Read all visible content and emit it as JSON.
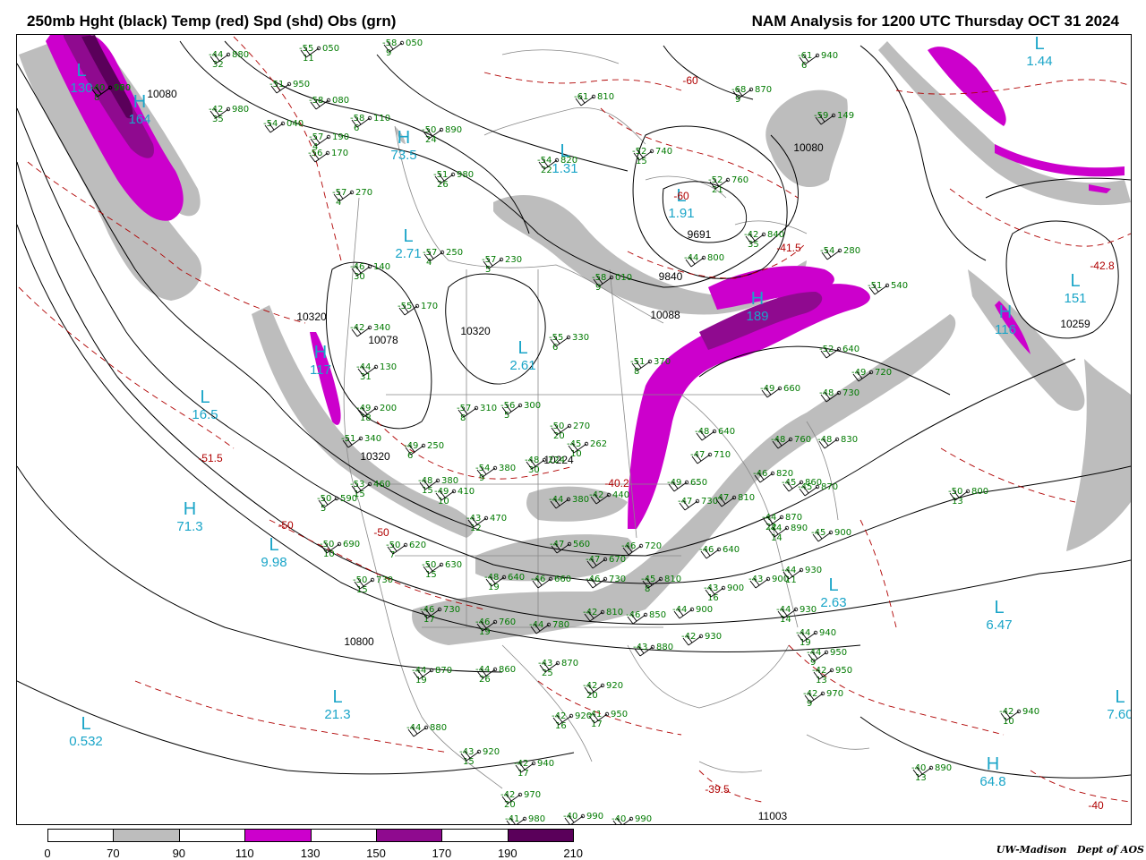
{
  "header": {
    "left_title": "250mb Hght (black) Temp (red) Spd (shd) Obs (grn)",
    "right_title": "NAM Analysis for 1200 UTC Thursday  OCT 31 2024"
  },
  "colors": {
    "height_contours": "#000000",
    "temperature_contours": "#b00000",
    "observations": "#007a00",
    "center_labels": "#1aa5c8",
    "speed_70_90": "#bdbdbd",
    "speed_110_130": "#cc00cc",
    "speed_150_170": "#8f0a8f",
    "speed_190_210": "#5a005a"
  },
  "centers": [
    {
      "type": "L",
      "value": "1.44"
    },
    {
      "type": "H",
      "value": "164"
    },
    {
      "type": "L",
      "value": "130"
    },
    {
      "type": "H",
      "value": "73.5"
    },
    {
      "type": "L",
      "value": "1.31"
    },
    {
      "type": "L",
      "value": "1.91"
    },
    {
      "type": "L",
      "value": "2.71"
    },
    {
      "type": "L",
      "value": "2.61"
    },
    {
      "type": "L",
      "value": "16.5"
    },
    {
      "type": "H",
      "value": "71.3"
    },
    {
      "type": "L",
      "value": "9.98"
    },
    {
      "type": "L",
      "value": "2.63"
    },
    {
      "type": "L",
      "value": "6.47"
    },
    {
      "type": "L",
      "value": "151"
    },
    {
      "type": "H",
      "value": "116"
    },
    {
      "type": "H",
      "value": "189"
    },
    {
      "type": "L",
      "value": "21.3"
    },
    {
      "type": "L",
      "value": "0.532"
    },
    {
      "type": "H",
      "value": "64.8"
    },
    {
      "type": "L",
      "value": "7.60"
    },
    {
      "type": "H",
      "value": "117"
    }
  ],
  "height_labels": [
    "10080",
    "10080",
    "9691",
    "9840",
    "10088",
    "10320",
    "10078",
    "10320",
    "10320",
    "10800",
    "10259",
    "10224",
    "11003"
  ],
  "temp_labels": [
    "-60",
    "-60",
    "-41.5",
    "-42.8",
    "-51.5",
    "-50",
    "-50",
    "-40.2",
    "-39.5",
    "-40"
  ],
  "observations": [
    {
      "t": "-44",
      "h": "880",
      "d": "32"
    },
    {
      "t": "-42",
      "h": "980",
      "d": "35"
    },
    {
      "t": "-55",
      "h": "050",
      "d": "11"
    },
    {
      "t": "-58",
      "h": "050",
      "d": "9"
    },
    {
      "t": "-51",
      "h": "950",
      "d": ""
    },
    {
      "t": "-58",
      "h": "080",
      "d": ""
    },
    {
      "t": "-54",
      "h": "040",
      "d": ""
    },
    {
      "t": "-57",
      "h": "190",
      "d": "4"
    },
    {
      "t": "-58",
      "h": "110",
      "d": "6"
    },
    {
      "t": "-56",
      "h": "170",
      "d": ""
    },
    {
      "t": "-57",
      "h": "270",
      "d": "4"
    },
    {
      "t": "-61",
      "h": "810",
      "d": ""
    },
    {
      "t": "-68",
      "h": "870",
      "d": "9"
    },
    {
      "t": "-61",
      "h": "940",
      "d": "6"
    },
    {
      "t": "-59",
      "h": "149",
      "d": ""
    },
    {
      "t": "-50",
      "h": "890",
      "d": "24"
    },
    {
      "t": "-54",
      "h": "820",
      "d": "22"
    },
    {
      "t": "-52",
      "h": "740",
      "d": "15"
    },
    {
      "t": "-52",
      "h": "760",
      "d": "21"
    },
    {
      "t": "-51",
      "h": "980",
      "d": "26"
    },
    {
      "t": "-42",
      "h": "840",
      "d": "35"
    },
    {
      "t": "-44",
      "h": "800",
      "d": ""
    },
    {
      "t": "-54",
      "h": "280",
      "d": ""
    },
    {
      "t": "-57",
      "h": "250",
      "d": "4"
    },
    {
      "t": "-57",
      "h": "230",
      "d": "5"
    },
    {
      "t": "-58",
      "h": "010",
      "d": "9"
    },
    {
      "t": "-55",
      "h": "170",
      "d": ""
    },
    {
      "t": "-51",
      "h": "540",
      "d": ""
    },
    {
      "t": "-46",
      "h": "140",
      "d": "30"
    },
    {
      "t": "-42",
      "h": "340",
      "d": ""
    },
    {
      "t": "-55",
      "h": "330",
      "d": "6"
    },
    {
      "t": "-51",
      "h": "370",
      "d": "8"
    },
    {
      "t": "-44",
      "h": "130",
      "d": "31"
    },
    {
      "t": "-49",
      "h": "200",
      "d": "18"
    },
    {
      "t": "-57",
      "h": "310",
      "d": "8"
    },
    {
      "t": "-56",
      "h": "300",
      "d": "5"
    },
    {
      "t": "-50",
      "h": "270",
      "d": "20"
    },
    {
      "t": "-52",
      "h": "640",
      "d": ""
    },
    {
      "t": "-49",
      "h": "720",
      "d": ""
    },
    {
      "t": "-49",
      "h": "660",
      "d": ""
    },
    {
      "t": "-48",
      "h": "730",
      "d": ""
    },
    {
      "t": "-51",
      "h": "340",
      "d": ""
    },
    {
      "t": "-49",
      "h": "250",
      "d": "6"
    },
    {
      "t": "-45",
      "h": "262",
      "d": "10"
    },
    {
      "t": "-48",
      "h": "224",
      "d": "30"
    },
    {
      "t": "-54",
      "h": "380",
      "d": "9"
    },
    {
      "t": "-48",
      "h": "760",
      "d": ""
    },
    {
      "t": "-48",
      "h": "640",
      "d": ""
    },
    {
      "t": "-48",
      "h": "830",
      "d": ""
    },
    {
      "t": "-53",
      "h": "460",
      "d": "15"
    },
    {
      "t": "-48",
      "h": "380",
      "d": "15"
    },
    {
      "t": "-49",
      "h": "410",
      "d": "10"
    },
    {
      "t": "-44",
      "h": "380",
      "d": ""
    },
    {
      "t": "-42",
      "h": "440",
      "d": ""
    },
    {
      "t": "-49",
      "h": "650",
      "d": ""
    },
    {
      "t": "-47",
      "h": "730",
      "d": ""
    },
    {
      "t": "-46",
      "h": "820",
      "d": ""
    },
    {
      "t": "-45",
      "h": "860",
      "d": ""
    },
    {
      "t": "-45",
      "h": "870",
      "d": ""
    },
    {
      "t": "-50",
      "h": "800",
      "d": "13"
    },
    {
      "t": "-50",
      "h": "590",
      "d": "5"
    },
    {
      "t": "-43",
      "h": "470",
      "d": "12"
    },
    {
      "t": "-47",
      "h": "710",
      "d": ""
    },
    {
      "t": "-47",
      "h": "810",
      "d": ""
    },
    {
      "t": "-44",
      "h": "870",
      "d": "22"
    },
    {
      "t": "-44",
      "h": "890",
      "d": "14"
    },
    {
      "t": "-45",
      "h": "900",
      "d": ""
    },
    {
      "t": "-50",
      "h": "690",
      "d": "10"
    },
    {
      "t": "-50",
      "h": "620",
      "d": "7"
    },
    {
      "t": "-50",
      "h": "630",
      "d": "15"
    },
    {
      "t": "-47",
      "h": "560",
      "d": ""
    },
    {
      "t": "-47",
      "h": "670",
      "d": ""
    },
    {
      "t": "-46",
      "h": "720",
      "d": ""
    },
    {
      "t": "-46",
      "h": "640",
      "d": ""
    },
    {
      "t": "-50",
      "h": "730",
      "d": "15"
    },
    {
      "t": "-48",
      "h": "640",
      "d": "19"
    },
    {
      "t": "-46",
      "h": "660",
      "d": ""
    },
    {
      "t": "-46",
      "h": "730",
      "d": ""
    },
    {
      "t": "-45",
      "h": "810",
      "d": "8"
    },
    {
      "t": "-43",
      "h": "900",
      "d": "16"
    },
    {
      "t": "-43",
      "h": "900",
      "d": ""
    },
    {
      "t": "-44",
      "h": "930",
      "d": "11"
    },
    {
      "t": "-46",
      "h": "730",
      "d": "17"
    },
    {
      "t": "-46",
      "h": "760",
      "d": "19"
    },
    {
      "t": "-44",
      "h": "780",
      "d": ""
    },
    {
      "t": "-42",
      "h": "810",
      "d": ""
    },
    {
      "t": "-46",
      "h": "850",
      "d": ""
    },
    {
      "t": "-44",
      "h": "900",
      "d": ""
    },
    {
      "t": "-44",
      "h": "930",
      "d": "14"
    },
    {
      "t": "-43",
      "h": "880",
      "d": ""
    },
    {
      "t": "-42",
      "h": "930",
      "d": ""
    },
    {
      "t": "-44",
      "h": "940",
      "d": "19"
    },
    {
      "t": "-44",
      "h": "950",
      "d": "9"
    },
    {
      "t": "-42",
      "h": "950",
      "d": "13"
    },
    {
      "t": "-42",
      "h": "970",
      "d": "9"
    },
    {
      "t": "-44",
      "h": "870",
      "d": "19"
    },
    {
      "t": "-44",
      "h": "860",
      "d": "26"
    },
    {
      "t": "-43",
      "h": "870",
      "d": "25"
    },
    {
      "t": "-42",
      "h": "920",
      "d": "20"
    },
    {
      "t": "-42",
      "h": "920",
      "d": "16"
    },
    {
      "t": "-41",
      "h": "950",
      "d": "17"
    },
    {
      "t": "-42",
      "h": "940",
      "d": "10"
    },
    {
      "t": "-44",
      "h": "880",
      "d": ""
    },
    {
      "t": "-43",
      "h": "920",
      "d": "15"
    },
    {
      "t": "-42",
      "h": "940",
      "d": "17"
    },
    {
      "t": "-42",
      "h": "970",
      "d": "20"
    },
    {
      "t": "-41",
      "h": "980",
      "d": "26"
    },
    {
      "t": "-40",
      "h": "990",
      "d": ""
    },
    {
      "t": "-40",
      "h": "990",
      "d": "12"
    },
    {
      "t": "-40",
      "h": "890",
      "d": "13"
    },
    {
      "t": "-40",
      "h": "990",
      "d": ""
    },
    {
      "t": "-40",
      "h": "960",
      "d": "8"
    }
  ],
  "legend": {
    "ticks": [
      "0",
      "70",
      "90",
      "110",
      "130",
      "150",
      "170",
      "190",
      "210"
    ],
    "fills": [
      "#ffffff",
      "#bdbdbd",
      "#ffffff",
      "#cc00cc",
      "#ffffff",
      "#8f0a8f",
      "#ffffff",
      "#5a005a"
    ]
  },
  "credit": {
    "org": "UW-Madison",
    "dept": "Dept of AOS"
  }
}
